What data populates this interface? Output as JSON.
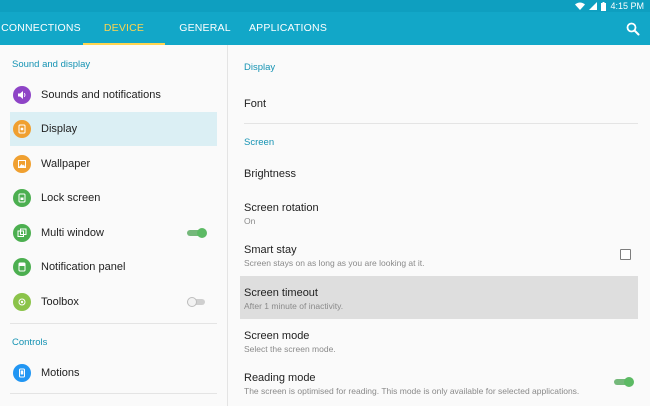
{
  "status_bar": {
    "time": "4:15 PM"
  },
  "tabs": [
    {
      "label": "CONNECTIONS",
      "active": false
    },
    {
      "label": "DEVICE",
      "active": true
    },
    {
      "label": "GENERAL",
      "active": false
    },
    {
      "label": "APPLICATIONS",
      "active": false
    }
  ],
  "left_panel": {
    "section_sound": "Sound and display",
    "section_controls": "Controls",
    "items": [
      {
        "label": "Sounds and notifications",
        "icon": "speaker-icon",
        "color": "#8e44c6"
      },
      {
        "label": "Display",
        "icon": "display-icon",
        "color": "#f0a030",
        "selected": true
      },
      {
        "label": "Wallpaper",
        "icon": "wallpaper-icon",
        "color": "#f0a030"
      },
      {
        "label": "Lock screen",
        "icon": "lock-screen-icon",
        "color": "#4caf50"
      },
      {
        "label": "Multi window",
        "icon": "multi-window-icon",
        "color": "#4caf50",
        "toggle": "on"
      },
      {
        "label": "Notification panel",
        "icon": "notification-panel-icon",
        "color": "#4caf50"
      },
      {
        "label": "Toolbox",
        "icon": "toolbox-icon",
        "color": "#8bc34a",
        "toggle": "off"
      },
      {
        "label": "Motions",
        "icon": "motions-icon",
        "color": "#2196f3"
      }
    ]
  },
  "right_panel": {
    "section_display": "Display",
    "section_screen": "Screen",
    "items": [
      {
        "title": "Font",
        "subtitle": ""
      },
      {
        "title": "Brightness",
        "subtitle": ""
      },
      {
        "title": "Screen rotation",
        "subtitle": "On"
      },
      {
        "title": "Smart stay",
        "subtitle": "Screen stays on as long as you are looking at it.",
        "control": "checkbox-unchecked"
      },
      {
        "title": "Screen timeout",
        "subtitle": "After 1 minute of inactivity.",
        "highlighted": true
      },
      {
        "title": "Screen mode",
        "subtitle": "Select the screen mode."
      },
      {
        "title": "Reading mode",
        "subtitle": "The screen is optimised for reading. This mode is only available for selected applications.",
        "control": "toggle-on"
      }
    ]
  },
  "colors": {
    "status_bar": "#0e9fc0",
    "tab_bar": "#12a7c8",
    "active_tab": "#ffd54f",
    "section_header": "#1593b3",
    "selected_row": "#dbeff4",
    "toggle_on": "#5cba64"
  }
}
